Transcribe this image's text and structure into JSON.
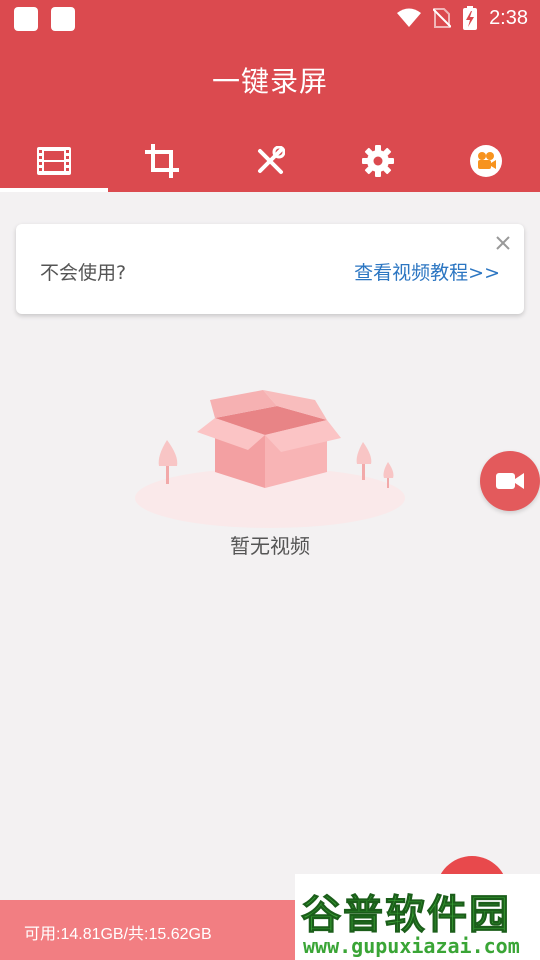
{
  "status_bar": {
    "time": "2:38",
    "icons": [
      "notification-square-icon",
      "notification-square-icon",
      "wifi-icon",
      "no-sim-icon",
      "battery-charging-icon"
    ]
  },
  "app": {
    "title": "一键录屏",
    "tabs": [
      {
        "icon": "film-icon",
        "name": "videos"
      },
      {
        "icon": "crop-icon",
        "name": "crop"
      },
      {
        "icon": "tools-icon",
        "name": "tools"
      },
      {
        "icon": "gear-icon",
        "name": "settings"
      },
      {
        "icon": "camera-badge-icon",
        "name": "camera"
      }
    ],
    "active_tab": 0
  },
  "tip": {
    "text": "不会使用?",
    "link": "查看视频教程>>"
  },
  "empty_state": {
    "text": "暂无视频"
  },
  "storage": {
    "text": "可用:14.81GB/共:15.62GB"
  },
  "watermark": {
    "title": "谷普软件园",
    "url": "www.gupuxiazai.com"
  },
  "colors": {
    "primary": "#db4a4f",
    "link": "#2c76c2",
    "fab": "#e35a5c",
    "bottom_bar": "#f27e82",
    "camera_badge": "#f7931e"
  }
}
